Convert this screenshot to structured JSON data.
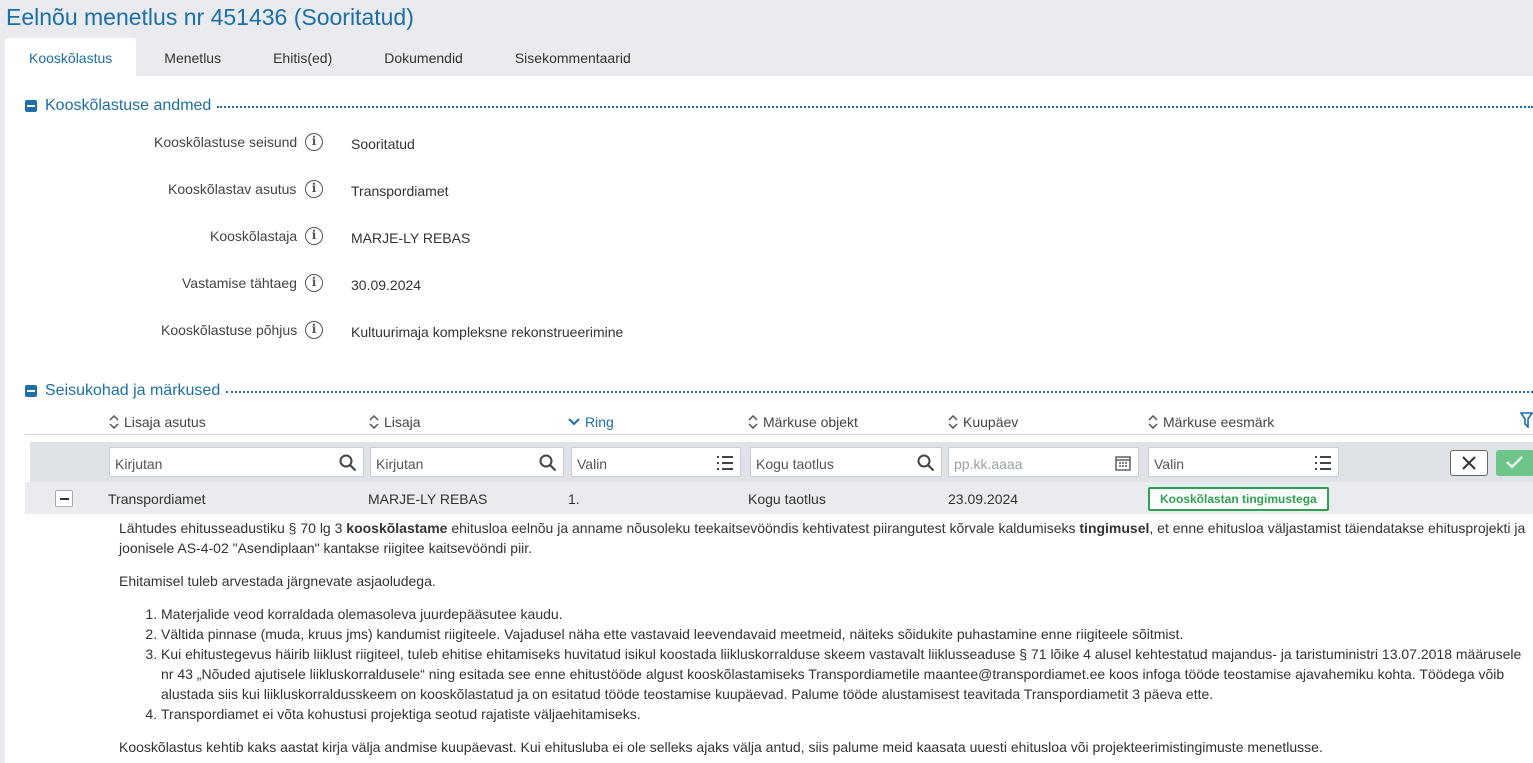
{
  "page_title": "Eelnõu menetlus nr 451436 (Sooritatud)",
  "tabs": [
    {
      "label": "Kooskõlastus",
      "active": true
    },
    {
      "label": "Menetlus"
    },
    {
      "label": "Ehitis(ed)"
    },
    {
      "label": "Dokumendid"
    },
    {
      "label": "Sisekommentaarid"
    }
  ],
  "section1": {
    "title": "Kooskõlastuse andmed",
    "fields": [
      {
        "label": "Kooskõlastuse seisund",
        "value": "Sooritatud"
      },
      {
        "label": "Kooskõlastav asutus",
        "value": "Transpordiamet"
      },
      {
        "label": "Kooskõlastaja",
        "value": "MARJE-LY REBAS"
      },
      {
        "label": "Vastamise tähtaeg",
        "value": "30.09.2024"
      },
      {
        "label": "Kooskõlastuse põhjus",
        "value": "Kultuurimaja kompleksne rekonstrueerimine"
      }
    ]
  },
  "section2": {
    "title": "Seisukohad ja märkused",
    "columns": [
      {
        "label": "Lisaja asutus"
      },
      {
        "label": "Lisaja"
      },
      {
        "label": "Ring",
        "sorted": "desc"
      },
      {
        "label": "Märkuse objekt"
      },
      {
        "label": "Kuupäev"
      },
      {
        "label": "Märkuse eesmärk"
      }
    ],
    "filters": {
      "asutus": "Kirjutan",
      "lisaja": "Kirjutan",
      "ring": "Valin",
      "objekt": "Kogu taotlus",
      "kuupaev_placeholder": "pp.kk.aaaa",
      "eesmark": "Valin"
    },
    "row": {
      "asutus": "Transpordiamet",
      "lisaja": "MARJE-LY REBAS",
      "ring": "1.",
      "objekt": "Kogu taotlus",
      "kuupaev": "23.09.2024",
      "eesmark": "Kooskõlastan tingimustega"
    },
    "comment": {
      "p1_a": "Lähtudes ehitusseadustiku § 70 lg 3 ",
      "p1_b": "kooskõlastame",
      "p1_c": " ehitusloa eelnõu ja anname nõusoleku teekaitsevööndis kehtivatest piirangutest kõrvale kaldumiseks ",
      "p1_d": "tingimusel",
      "p1_e": ", et enne ehitusloa väljastamist täiendatakse ehitusprojekti ja joonisele AS-4-02 \"Asendiplaan\" kantakse riigitee kaitsevööndi piir.",
      "p2": "Ehitamisel tuleb arvestada järgnevate asjaoludega.",
      "items": [
        "Materjalide veod korraldada olemasoleva juurdepääsutee kaudu.",
        "Vältida pinnase (muda, kruus jms) kandumist riigiteele. Vajadusel näha ette vastavaid leevendavaid meetmeid, näiteks sõidukite puhastamine enne riigiteele sõitmist.",
        "Kui ehitustegevus häirib liiklust riigiteel, tuleb ehitise ehitamiseks huvitatud isikul koostada liikluskorralduse skeem vastavalt liiklusseaduse § 71 lõike 4 alusel kehtestatud majandus- ja taristuministri 13.07.2018 määrusele nr 43 „Nõuded ajutisele liikluskorraldusele“ ning esitada see enne ehitustööde algust kooskõlastamiseks Transpordiametile maantee@transpordiamet.ee koos infoga tööde teostamise ajavahemiku kohta. Töödega võib alustada siis kui liikluskorraldusskeem on kooskõlastatud ja on esitatud tööde teostamise kuupäevad. Palume tööde alustamisest teavitada Transpordiametit 3 päeva ette.",
        "Transpordiamet ei võta kohustusi projektiga seotud rajatiste väljaehitamiseks."
      ],
      "p3": "Kooskõlastus kehtib kaks aastat kirja välja andmise kuupäevast. Kui ehitusluba ei ole selleks ajaks välja antud, siis palume meid kaasata uuesti ehitusloa või projekteerimistingimuste menetlusse."
    }
  },
  "colors": {
    "accent": "#1c6fa8",
    "success": "#2ea052",
    "apply_button": "#6ec58a"
  }
}
